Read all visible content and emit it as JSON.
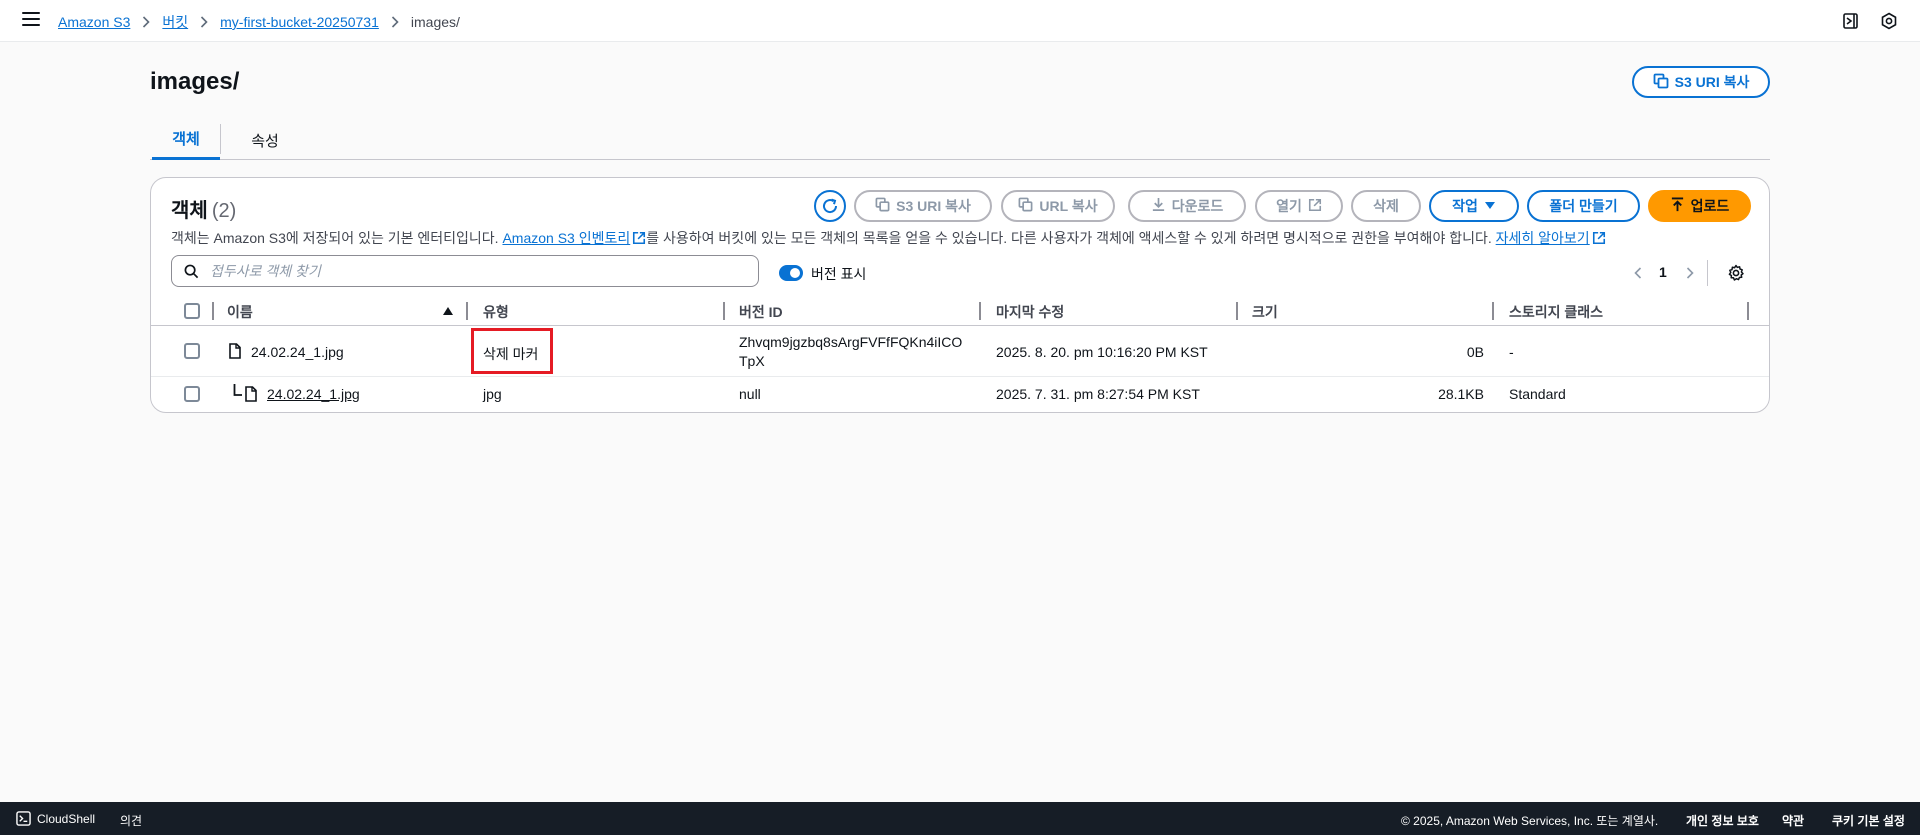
{
  "breadcrumb": {
    "items": [
      "Amazon S3",
      "버킷",
      "my-first-bucket-20250731"
    ],
    "current": "images/"
  },
  "header": {
    "title": "images/",
    "copy_uri_label": "S3 URI 복사"
  },
  "tabs": [
    {
      "label": "객체",
      "active": true
    },
    {
      "label": "속성",
      "active": false
    }
  ],
  "objects": {
    "title": "객체",
    "count": "(2)",
    "description": {
      "part1": "객체는 Amazon S3에 저장되어 있는 기본 엔터티입니다.",
      "link1": "Amazon S3 인벤토리",
      "part2": "를 사용하여 버킷에 있는 모든 객체의 목록을 얻을 수 있습니다. 다른 사용자가 객체에 액세스할 수 있게 하려면 명시적으로 권한을 부여해야 합니다.",
      "link2": "자세히 알아보기"
    },
    "actions": {
      "copy_s3_uri": "S3 URI 복사",
      "copy_url": "URL 복사",
      "download": "다운로드",
      "open": "열기",
      "delete": "삭제",
      "actions": "작업",
      "create_folder": "폴더 만들기",
      "upload": "업로드"
    },
    "search_placeholder": "접두사로 객체 찾기",
    "show_versions_label": "버전 표시",
    "show_versions": true,
    "page": "1",
    "columns": [
      "이름",
      "유형",
      "버전 ID",
      "마지막 수정",
      "크기",
      "스토리지 클래스"
    ],
    "rows": [
      {
        "name": "24.02.24_1.jpg",
        "type": "삭제 마커",
        "version_line1": "Zhvqm9jgzbq8sArgFVFfFQKn4iICO",
        "version_line2": "TpX",
        "modified": "2025. 8. 20. pm 10:16:20 PM KST",
        "size": "0B",
        "storage": "-"
      },
      {
        "name": "24.02.24_1.jpg",
        "type": "jpg",
        "version": "null",
        "modified": "2025. 7. 31. pm 8:27:54 PM KST",
        "size": "28.1KB",
        "storage": "Standard"
      }
    ]
  },
  "footer": {
    "cloudshell": "CloudShell",
    "feedback": "의견",
    "copyright": "© 2025, Amazon Web Services, Inc. 또는 계열사.",
    "privacy": "개인 정보 보호",
    "terms": "약관",
    "cookies": "쿠키 기본 설정"
  },
  "colors": {
    "link": "#0972d3",
    "primary": "#ff9900",
    "highlight": "#e51b24",
    "footer_bg": "#161d26"
  }
}
